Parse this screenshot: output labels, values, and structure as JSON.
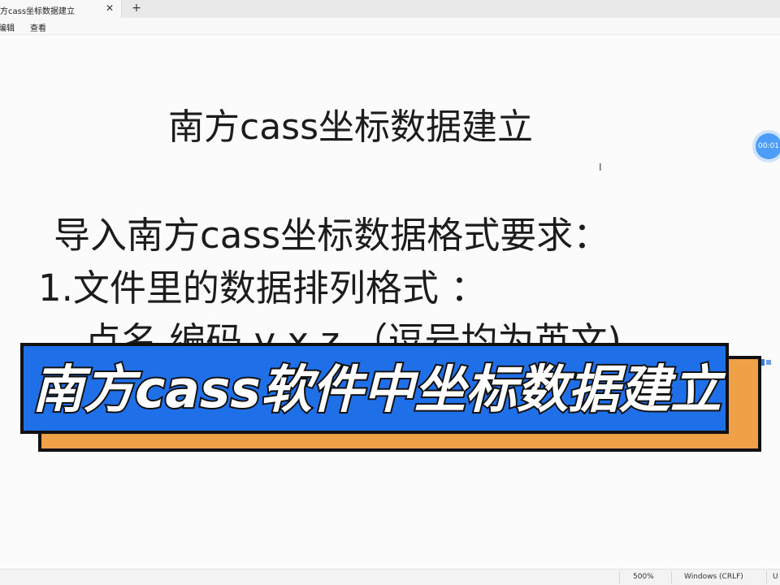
{
  "window": {
    "tab_title": "方cass坐标数据建立",
    "close_glyph": "✕",
    "add_glyph": "+"
  },
  "menu": {
    "items": [
      "编辑",
      "查看"
    ]
  },
  "document": {
    "lines": [
      "南方cass坐标数据建立",
      "导入南方cass坐标数据格式要求：",
      "1.文件里的数据排列格式 ：",
      "点名 编码 y x z （逗号均为英文)"
    ],
    "cursor_glyph": "I"
  },
  "overlay": {
    "banner_text": "南方cass软件中坐标数据建立",
    "colors": {
      "main": "#1f6fe8",
      "shadow": "#f0a046",
      "outline": "#111111"
    }
  },
  "recorder": {
    "timer": "00:01"
  },
  "status": {
    "zoom": "500%",
    "line_ending": "Windows (CRLF)",
    "encoding_partial": "U"
  }
}
